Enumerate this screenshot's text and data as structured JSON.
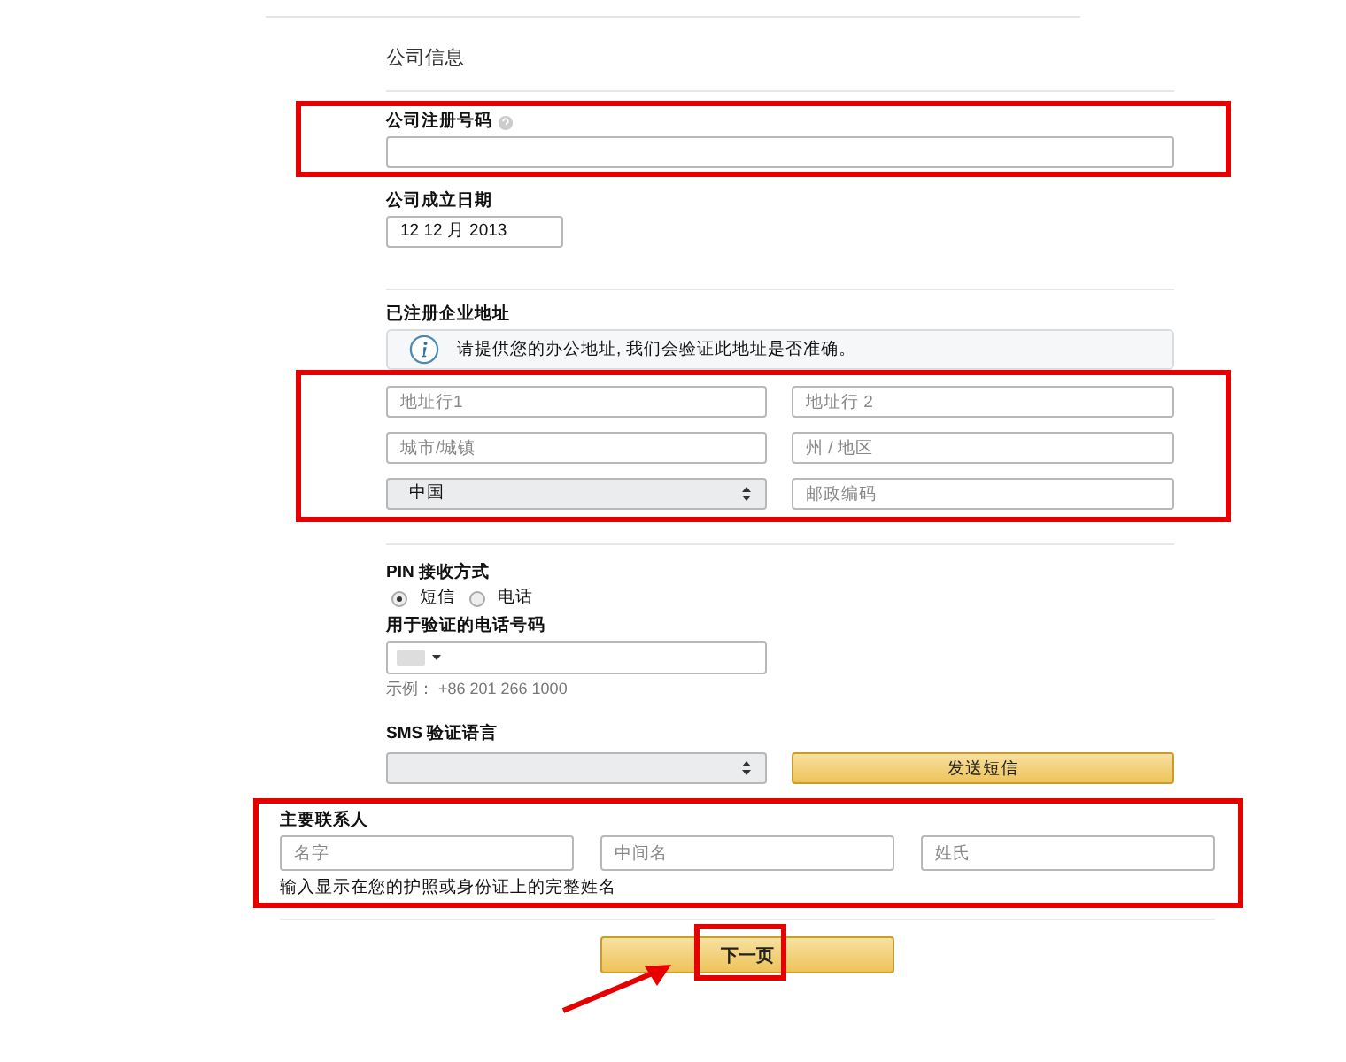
{
  "section_title": "公司信息",
  "registration_number": {
    "label": "公司注册号码",
    "highlighted": true
  },
  "establishment_date": {
    "label": "公司成立日期",
    "value": "12 12 月 2013"
  },
  "address": {
    "label": "已注册企业地址",
    "notice": "请提供您的办公地址, 我们会验证此地址是否准确。",
    "highlighted": true,
    "fields": [
      {
        "kind": "input",
        "placeholder": "地址行1"
      },
      {
        "kind": "input",
        "placeholder": "地址行 2"
      },
      {
        "kind": "input",
        "placeholder": "城市/城镇"
      },
      {
        "kind": "input",
        "placeholder": "州 / 地区"
      },
      {
        "kind": "select",
        "value": "中国"
      },
      {
        "kind": "input",
        "placeholder": "邮政编码"
      }
    ]
  },
  "pin_method": {
    "label": "PIN 接收方式",
    "options": [
      {
        "label": "短信",
        "selected": true
      },
      {
        "label": "电话",
        "selected": false
      }
    ]
  },
  "phone": {
    "label": "用于验证的电话号码",
    "example": "示例： +86 201 266 1000"
  },
  "sms_language": {
    "label": "SMS 验证语言",
    "button": "发送短信"
  },
  "primary_contact": {
    "label": "主要联系人",
    "highlighted": true,
    "fields": [
      {
        "placeholder": "名字"
      },
      {
        "placeholder": "中间名"
      },
      {
        "placeholder": "姓氏"
      }
    ],
    "hint": "输入显示在您的护照或身份证上的完整姓名"
  },
  "next_button": {
    "label": "下一页",
    "highlighted": true
  }
}
